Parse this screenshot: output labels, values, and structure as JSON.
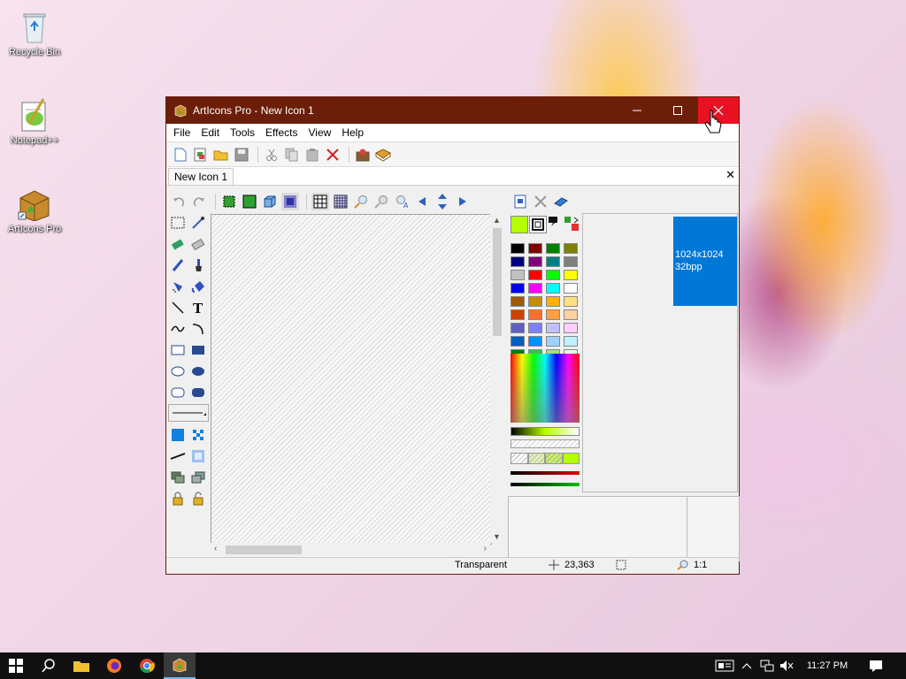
{
  "desktop": {
    "icons": [
      {
        "label": "Recycle Bin"
      },
      {
        "label": "Notepad++"
      },
      {
        "label": "ArtIcons Pro"
      }
    ]
  },
  "window": {
    "title": "ArtIcons Pro - New Icon 1",
    "menu": [
      "File",
      "Edit",
      "Tools",
      "Effects",
      "View",
      "Help"
    ],
    "tab_label": "New Icon 1",
    "format_item": {
      "size": "1024x1024",
      "depth": "32bpp"
    },
    "status": {
      "color": "Transparent",
      "coords": "23,363",
      "zoom": "1:1"
    }
  },
  "palette_colors": [
    "#000000",
    "#800000",
    "#008000",
    "#808000",
    "#000080",
    "#800080",
    "#008080",
    "#808080",
    "#c0c0c0",
    "#ff0000",
    "#00ff00",
    "#ffff00",
    "#0000ff",
    "#ff00ff",
    "#00ffff",
    "#ffffff",
    "#a05a00",
    "#c88c00",
    "#ffb000",
    "#ffe080",
    "#d04000",
    "#ff7030",
    "#ffa040",
    "#ffd0a0",
    "#6060c0",
    "#8080ff",
    "#c0c0ff",
    "#ffd0ff",
    "#0060c0",
    "#0090ff",
    "#a0d0ff",
    "#c0f0ff",
    "#008000",
    "#40c040",
    "#a0e080",
    "#e0ffe0"
  ],
  "taskbar": {
    "time": "11:27 PM"
  }
}
